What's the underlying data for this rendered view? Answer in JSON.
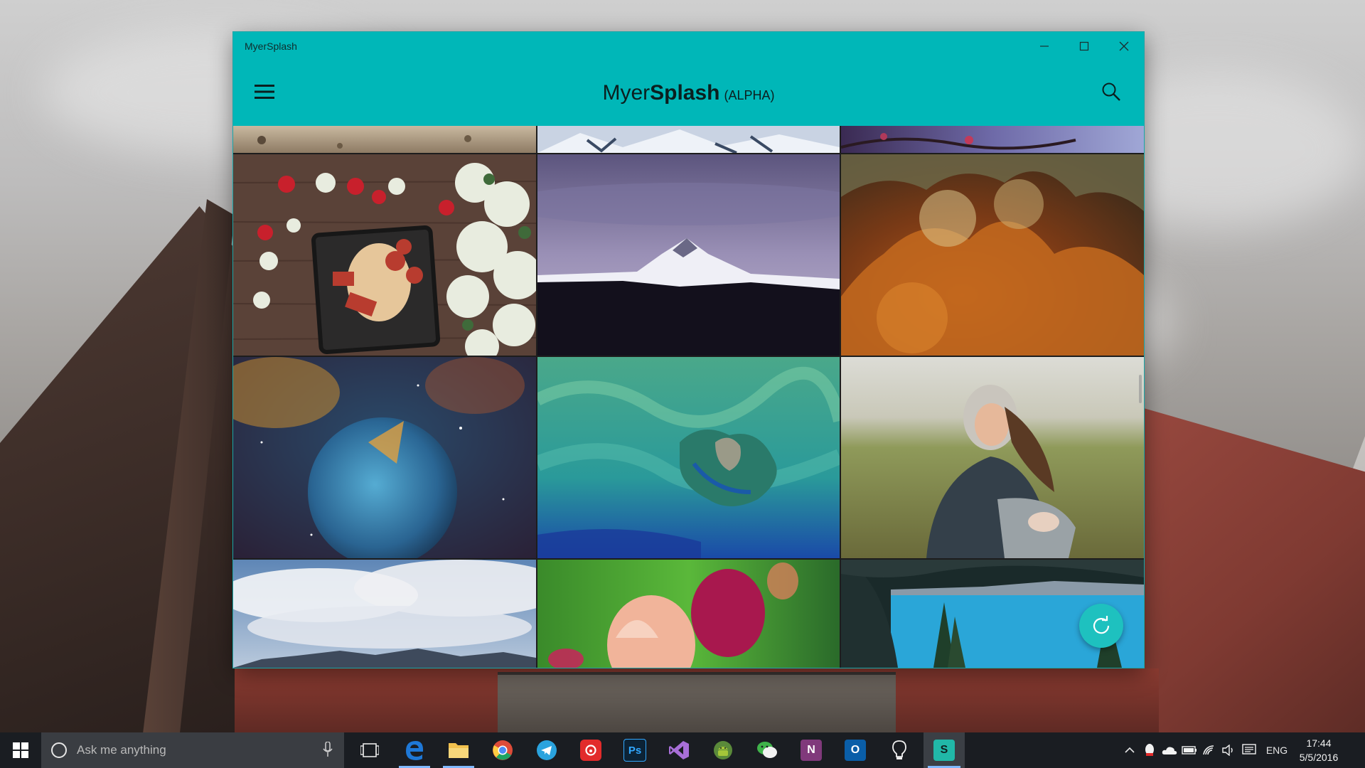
{
  "window": {
    "title": "MyerSplash",
    "controls": [
      "minimize-icon",
      "maximize-icon",
      "close-icon"
    ]
  },
  "appbar": {
    "brand_light": "Myer",
    "brand_bold": "Splash",
    "brand_tag": "(ALPHA)",
    "menu_icon": "hamburger-icon",
    "search_icon": "search-icon"
  },
  "gallery": {
    "photos": [
      {
        "name": "photo-desert-sand",
        "subject": "desert sand"
      },
      {
        "name": "photo-snowy-ridge",
        "subject": "snowy ridge"
      },
      {
        "name": "photo-cherry-branch",
        "subject": "cherry branch"
      },
      {
        "name": "photo-strawberries-flowers",
        "subject": "strawberries and white flowers"
      },
      {
        "name": "photo-snow-mountain",
        "subject": "snow capped mountain"
      },
      {
        "name": "photo-orange-nebula",
        "subject": "orange nebula"
      },
      {
        "name": "photo-bubble-nebula",
        "subject": "bubble nebula"
      },
      {
        "name": "photo-ocean-island",
        "subject": "ocean island aerial"
      },
      {
        "name": "photo-smiling-girl",
        "subject": "smiling girl in field"
      },
      {
        "name": "photo-sky-clouds",
        "subject": "clouds over mountains"
      },
      {
        "name": "photo-tulips",
        "subject": "tulips"
      },
      {
        "name": "photo-lake-trees",
        "subject": "lake and pine trees"
      }
    ],
    "refresh_icon": "refresh-icon",
    "accent": "#00b7b8"
  },
  "taskbar": {
    "search_placeholder": "Ask me anything",
    "apps": [
      {
        "name": "task-view",
        "icon": "task-view-icon",
        "color": "#1a1d22"
      },
      {
        "name": "edge",
        "icon": "edge-icon",
        "color": "#1e78d7",
        "active": true
      },
      {
        "name": "file-explorer",
        "icon": "folder-icon",
        "color": "#f2c14e",
        "active": true
      },
      {
        "name": "chrome",
        "icon": "chrome-icon",
        "color": "#dd4b39"
      },
      {
        "name": "telegram",
        "icon": "telegram-icon",
        "color": "#2aa3de"
      },
      {
        "name": "netease-music",
        "icon": "music-icon",
        "color": "#e22b2b"
      },
      {
        "name": "photoshop",
        "icon": "photoshop-icon",
        "color": "#0c2336",
        "label": "Ps"
      },
      {
        "name": "visual-studio",
        "icon": "visual-studio-icon",
        "color": "#6a2c91"
      },
      {
        "name": "android-studio",
        "icon": "android-icon",
        "color": "#7cbd3b"
      },
      {
        "name": "wechat",
        "icon": "wechat-icon",
        "color": "#3fb34a"
      },
      {
        "name": "onenote",
        "icon": "onenote-icon",
        "color": "#80397b",
        "label": "N"
      },
      {
        "name": "outlook",
        "icon": "outlook-icon",
        "color": "#0a5ea8",
        "label": "O"
      },
      {
        "name": "tips",
        "icon": "lightbulb-icon",
        "color": "#1a1d22"
      },
      {
        "name": "myersplash",
        "icon": "myersplash-icon",
        "color": "#21b8a8",
        "label": "S",
        "current": true
      }
    ],
    "tray": {
      "icons": [
        "chevron-up-icon",
        "qq-icon",
        "onedrive-icon",
        "battery-icon",
        "wifi-icon",
        "volume-icon",
        "action-center-icon"
      ],
      "language": "ENG",
      "time": "17:44",
      "date": "5/5/2016"
    }
  }
}
